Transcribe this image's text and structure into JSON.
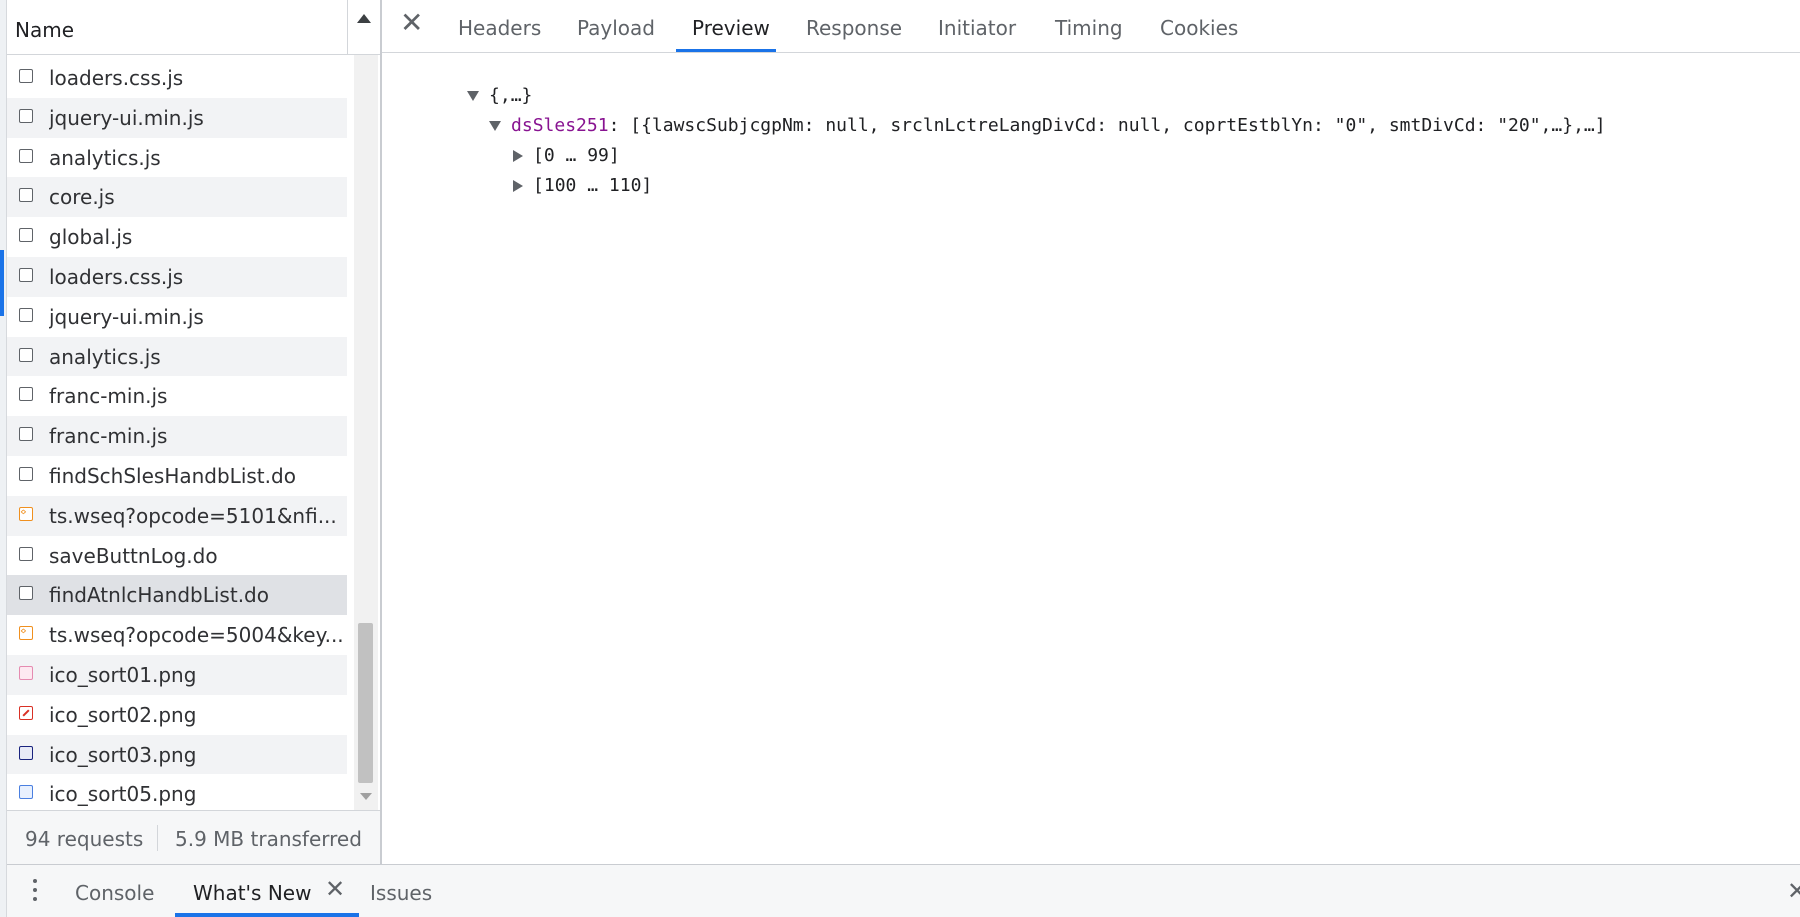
{
  "request_list": {
    "header": {
      "name_label": "Name"
    },
    "rows": [
      {
        "label": "loaders.css.js",
        "icon": "document-icon"
      },
      {
        "label": "jquery-ui.min.js",
        "icon": "document-icon"
      },
      {
        "label": "analytics.js",
        "icon": "document-icon"
      },
      {
        "label": "core.js",
        "icon": "document-icon"
      },
      {
        "label": "global.js",
        "icon": "document-icon"
      },
      {
        "label": "loaders.css.js",
        "icon": "document-icon"
      },
      {
        "label": "jquery-ui.min.js",
        "icon": "document-icon"
      },
      {
        "label": "analytics.js",
        "icon": "document-icon"
      },
      {
        "label": "franc-min.js",
        "icon": "document-icon"
      },
      {
        "label": "franc-min.js",
        "icon": "document-icon"
      },
      {
        "label": "findSchSlesHandbList.do",
        "icon": "document-icon"
      },
      {
        "label": "ts.wseq?opcode=5101&nfi...",
        "icon": "script-icon"
      },
      {
        "label": "saveButtnLog.do",
        "icon": "document-icon"
      },
      {
        "label": "findAtnlcHandbList.do",
        "icon": "document-icon"
      },
      {
        "label": "ts.wseq?opcode=5004&key...",
        "icon": "script-icon"
      },
      {
        "label": "ico_sort01.png",
        "icon": "image-icon"
      },
      {
        "label": "ico_sort02.png",
        "icon": "image-icon"
      },
      {
        "label": "ico_sort03.png",
        "icon": "image-icon"
      },
      {
        "label": "ico_sort05.png",
        "icon": "image-icon"
      }
    ],
    "status": {
      "requests": "94 requests",
      "transferred": "5.9 MB transferred"
    }
  },
  "detail": {
    "close_icon": "close-icon",
    "tabs": [
      {
        "label": "Headers"
      },
      {
        "label": "Payload"
      },
      {
        "label": "Preview"
      },
      {
        "label": "Response"
      },
      {
        "label": "Initiator"
      },
      {
        "label": "Timing"
      },
      {
        "label": "Cookies"
      }
    ],
    "active_tab": "Preview",
    "preview": {
      "root": "{,…}",
      "key": "dsSles251",
      "value": ": [{lawscSubjcgpNm: null, srclnLctreLangDivCd: null, coprtEstblYn: \"0\", smtDivCd: \"20\",…},…]",
      "range1": "[0 … 99]",
      "range2": "[100 … 110]"
    }
  },
  "drawer": {
    "tabs": [
      {
        "label": "Console"
      },
      {
        "label": "What's New"
      },
      {
        "label": "Issues"
      }
    ],
    "active_tab": "What's New"
  },
  "colors": {
    "accent": "#1a73e8",
    "json_key": "#881391",
    "script_icon": "#f0901f"
  }
}
